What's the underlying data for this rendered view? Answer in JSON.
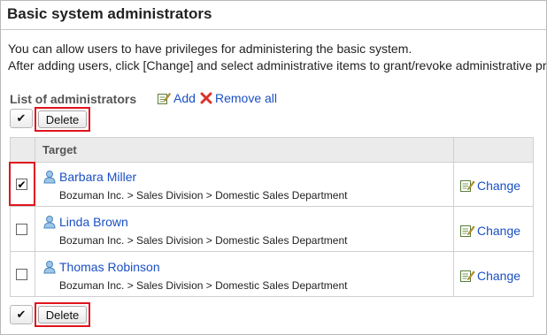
{
  "page": {
    "title": "Basic system administrators",
    "description_lines": [
      "You can allow users to have privileges for administering the basic system.",
      "After adding users, click [Change] and select administrative items to grant/revoke administrative privileges."
    ]
  },
  "list": {
    "heading": "List of administrators",
    "add_label": "Add",
    "remove_all_label": "Remove all",
    "select_all_mark": "✔",
    "delete_label": "Delete",
    "column_target": "Target",
    "change_label": "Change",
    "rows": [
      {
        "name": "Barbara Miller",
        "org": "Bozuman Inc. > Sales Division > Domestic Sales Department",
        "checked": true,
        "check_mark": "✔"
      },
      {
        "name": "Linda Brown",
        "org": "Bozuman Inc. > Sales Division > Domestic Sales Department",
        "checked": false,
        "check_mark": ""
      },
      {
        "name": "Thomas Robinson",
        "org": "Bozuman Inc. > Sales Division > Domestic Sales Department",
        "checked": false,
        "check_mark": ""
      }
    ]
  },
  "icons": {
    "add": "add-icon",
    "remove_all": "remove-all-x-icon",
    "user": "user-icon",
    "change": "change-edit-icon"
  },
  "colors": {
    "link": "#1a4fc4",
    "highlight": "#e0141e",
    "header_bg": "#ebebeb"
  }
}
